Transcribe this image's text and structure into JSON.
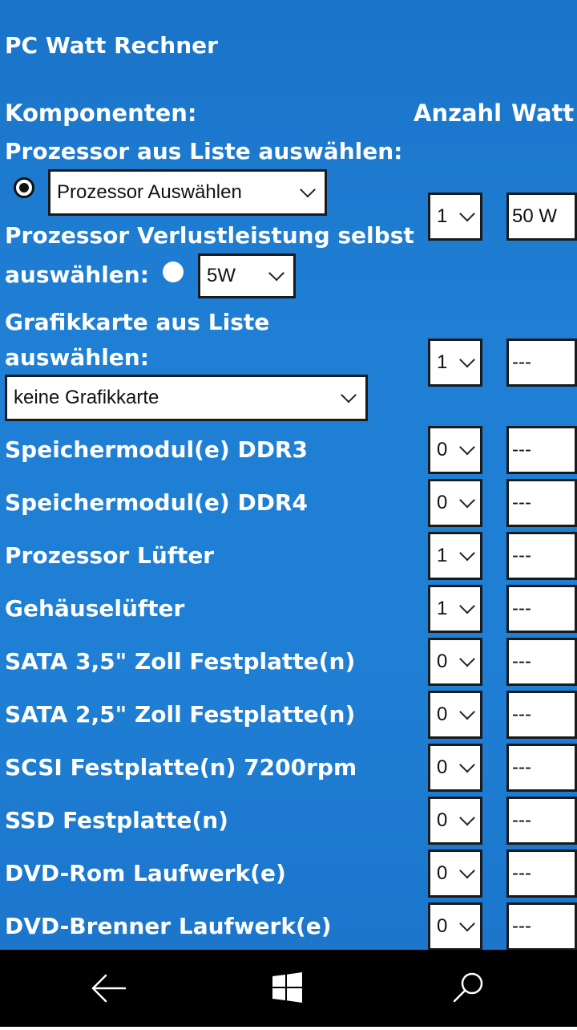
{
  "app": {
    "title": "PC Watt Rechner"
  },
  "header": {
    "components": "Komponenten:",
    "count": "Anzahl",
    "watt": "Watt"
  },
  "cpu": {
    "list_label": "Prozessor aus Liste auswählen:",
    "select_value": "Prozessor Auswählen",
    "custom_label_line1": "Prozessor Verlustleistung selbst",
    "custom_label_line2": "auswählen:",
    "custom_value": "5W",
    "count": "1",
    "watt": "50 W",
    "mode": "list"
  },
  "gpu": {
    "label_line1": "Grafikkarte aus Liste",
    "label_line2": "auswählen:",
    "select_value": "keine Grafikkarte",
    "count": "1",
    "watt": "---"
  },
  "rows": [
    {
      "label": "Speichermodul(e) DDR3",
      "count": "0",
      "watt": "---"
    },
    {
      "label": "Speichermodul(e) DDR4",
      "count": "0",
      "watt": "---"
    },
    {
      "label": "Prozessor Lüfter",
      "count": "1",
      "watt": "---"
    },
    {
      "label": "Gehäuselüfter",
      "count": "1",
      "watt": "---"
    },
    {
      "label": "SATA 3,5\" Zoll Festplatte(n)",
      "count": "0",
      "watt": "---"
    },
    {
      "label": "SATA 2,5\" Zoll Festplatte(n)",
      "count": "0",
      "watt": "---"
    },
    {
      "label": "SCSI Festplatte(n) 7200rpm",
      "count": "0",
      "watt": "---"
    },
    {
      "label": "SSD Festplatte(n)",
      "count": "0",
      "watt": "---"
    },
    {
      "label": "DVD-Rom Laufwerk(e)",
      "count": "0",
      "watt": "---"
    },
    {
      "label": "DVD-Brenner Laufwerk(e)",
      "count": "0",
      "watt": "---"
    }
  ],
  "navbar": {
    "icons": [
      "back-arrow-icon",
      "windows-logo-icon",
      "search-icon"
    ]
  },
  "colors": {
    "background": "#1f7fd4",
    "navbar": "#000000",
    "field": "#ffffff"
  }
}
